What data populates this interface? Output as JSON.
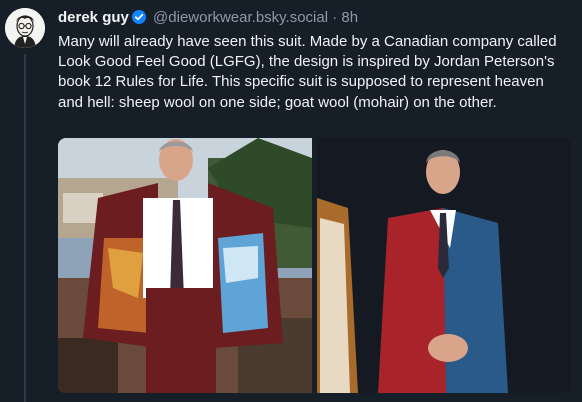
{
  "author": {
    "display_name": "derek guy",
    "handle": "@dieworkwear.bsky.social",
    "separator": "·",
    "timestamp": "8h",
    "verified": true
  },
  "post": {
    "text": "Many will already have seen this suit. Made by a Canadian company called Look Good Feel Good (LGFG), the design is inspired by Jordan Peterson's book 12 Rules for Life. This specific suit is supposed to represent heaven and hell: sheep wool on one side; goat wool (mohair) on the other."
  },
  "media": {
    "images": [
      {
        "name": "man-showing-suit-lining-photo"
      },
      {
        "name": "man-in-red-blue-suit-photo"
      }
    ]
  },
  "colors": {
    "background": "#161e27",
    "text": "#f1f3f5",
    "muted": "#8d9aab",
    "verified": "#1083fe"
  },
  "icons": {
    "verified": "verified-badge-icon",
    "avatar": "avatar-illustration"
  }
}
